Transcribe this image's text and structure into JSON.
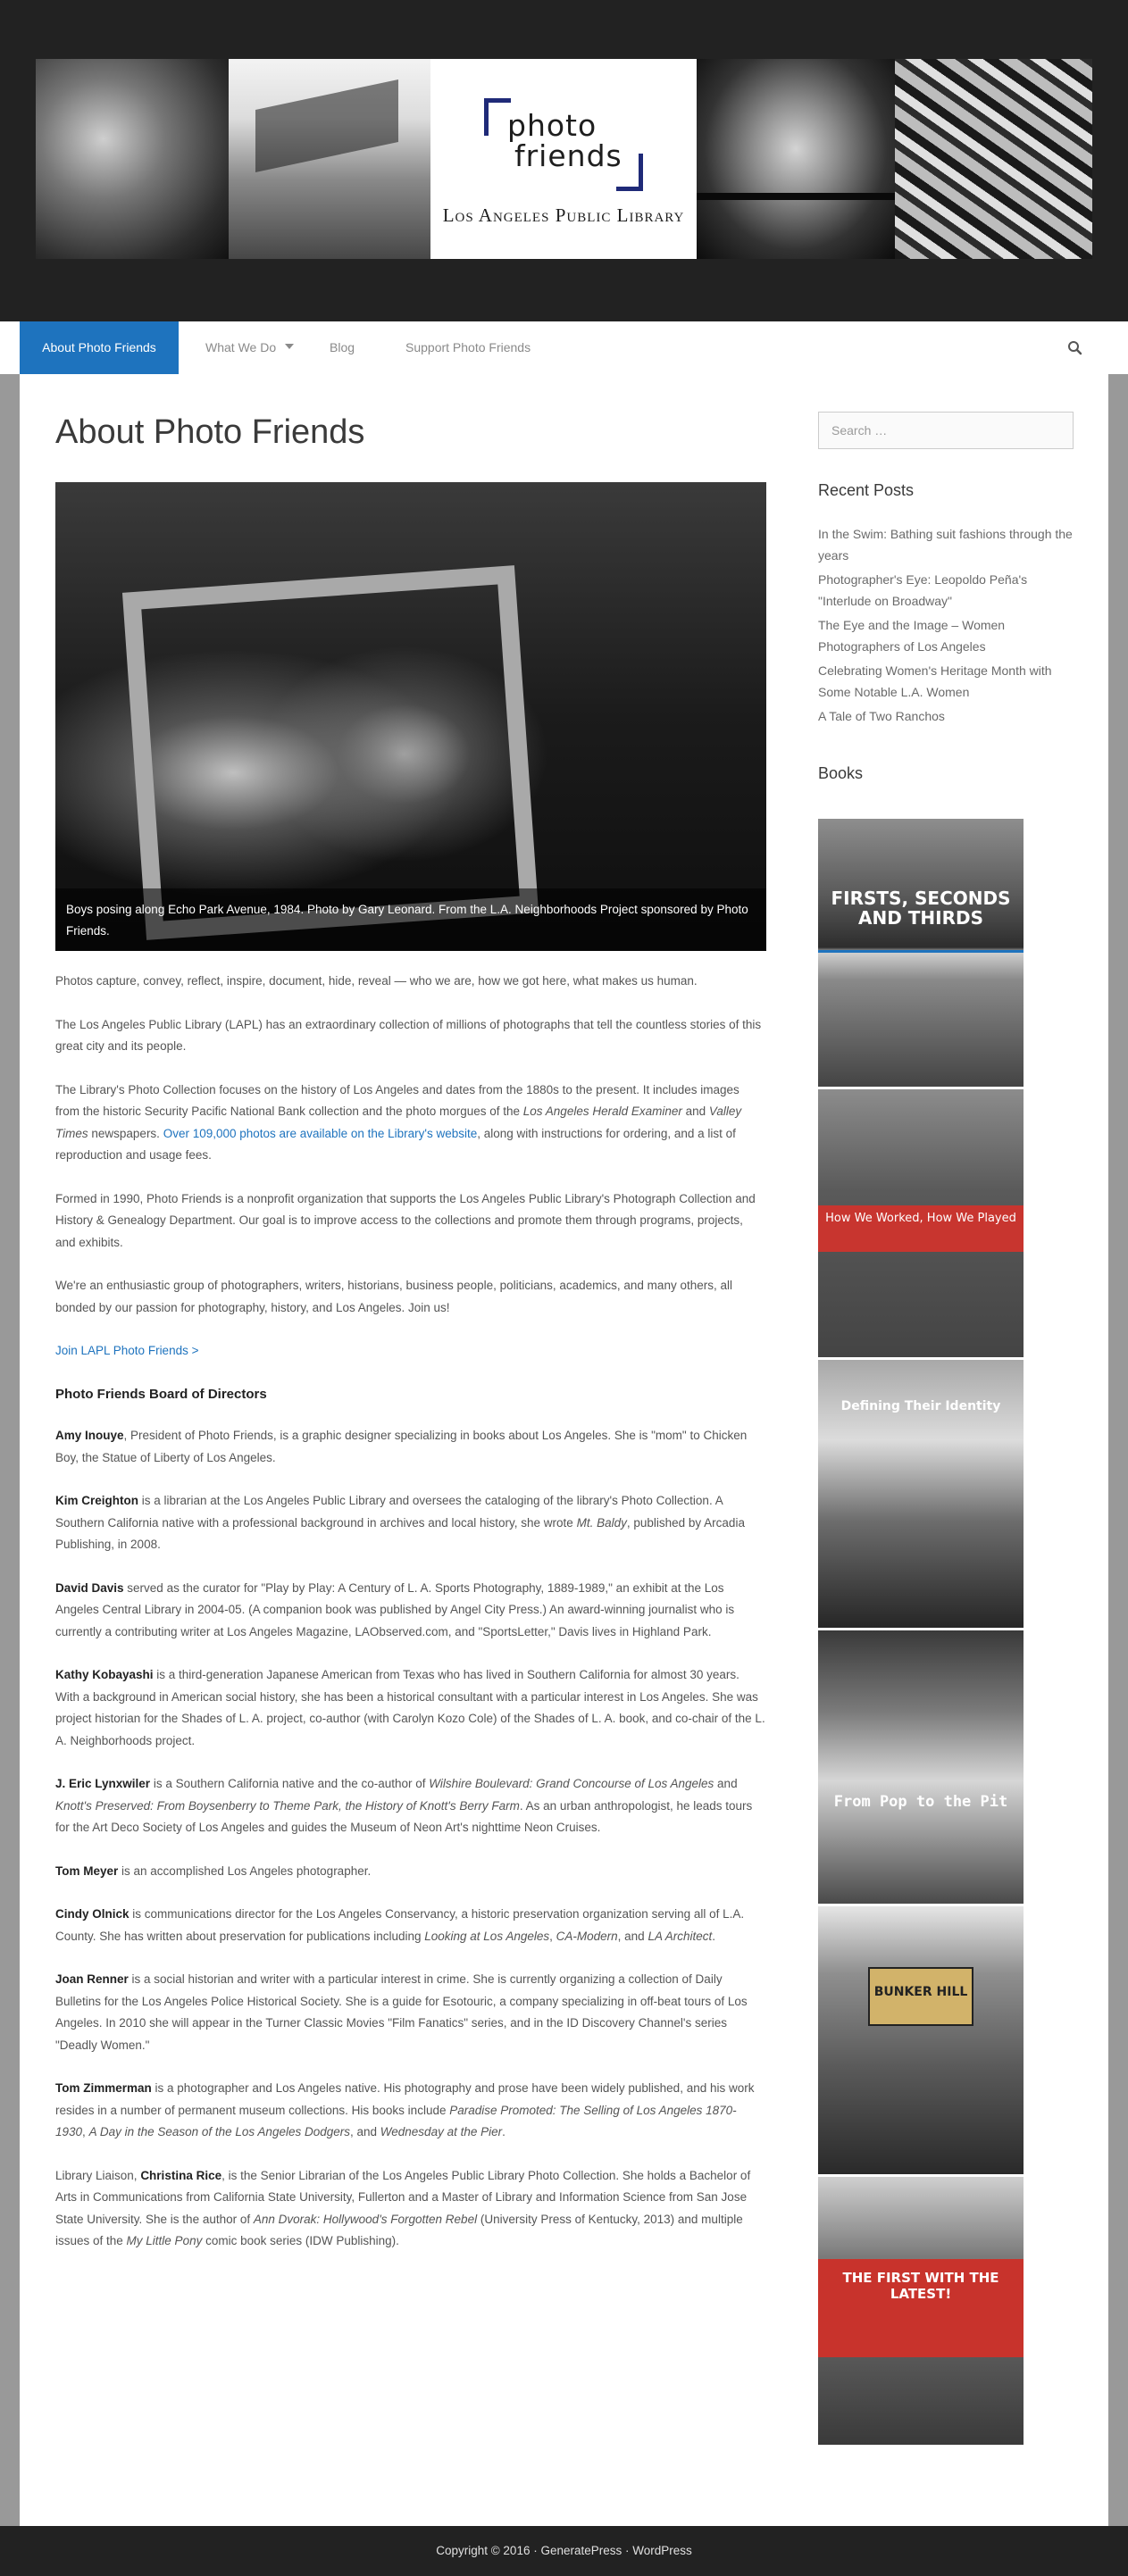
{
  "header": {
    "logo_line1": "photo",
    "logo_line2": "friends",
    "logo_sub": "Los Angeles Public Library"
  },
  "nav": {
    "items": [
      {
        "label": "About Photo Friends",
        "active": true
      },
      {
        "label": "What We Do",
        "active": false,
        "has_dropdown": true
      },
      {
        "label": "Blog",
        "active": false
      },
      {
        "label": "Support Photo Friends",
        "active": false
      }
    ],
    "search_icon": "search-icon"
  },
  "page": {
    "title": "About Photo Friends",
    "caption": "Boys posing along Echo Park Avenue, 1984. Photo by Gary Leonard. From the L.A. Neighborhoods Project sponsored by Photo Friends.",
    "p1": "Photos capture, convey, reflect, inspire, document, hide, reveal — who we are, how we got here, what makes us human.",
    "p2": "The Los Angeles Public Library (LAPL) has an extraordinary collection of millions of photographs that tell the countless stories of this great city and its people.",
    "p3a": "The Library's Photo Collection focuses on the history of Los Angeles and dates from the 1880s to the present. It includes images from the historic Security Pacific National Bank collection and the photo morgues of the ",
    "p3b": "Los Angeles Herald Examiner",
    "p3c": " and ",
    "p3d": "Valley Times",
    "p3e": " newspapers. ",
    "p3link": "Over 109,000 photos are available on the Library's website",
    "p3f": ", along with instructions for ordering, and a list of reproduction and usage fees.",
    "p4": "Formed in 1990, Photo Friends is a nonprofit organization that supports the Los Angeles Public Library's Photograph Collection and History & Genealogy Department. Our goal is to improve access to the collections and promote them through programs, projects, and exhibits.",
    "p5": "We're an enthusiastic group of photographers, writers, historians, business people, politicians, academics, and many others, all bonded by our passion for photography, history, and Los Angeles. Join us!",
    "join_link": "Join LAPL Photo Friends >",
    "board_heading": "Photo Friends Board of Directors",
    "board": [
      {
        "name": "Amy Inouye",
        "text": ", President of Photo Friends, is a graphic designer specializing in books about Los Angeles. She is \"mom\" to Chicken Boy, the Statue of Liberty of Los Angeles."
      },
      {
        "name": "Kim Creighton",
        "text": " is a librarian at the Los Angeles Public Library and oversees the cataloging of the library's Photo Collection. A Southern California native with a professional background in archives and local history, she wrote ",
        "em": "Mt. Baldy",
        "text2": ", published by Arcadia Publishing, in 2008."
      },
      {
        "name": "David Davis",
        "text": " served as the curator for \"Play by Play: A Century of L. A. Sports Photography, 1889-1989,\" an exhibit at the Los Angeles Central Library in 2004-05. (A companion book was published by Angel City Press.) An award-winning journalist who is currently a contributing writer at Los Angeles Magazine, LAObserved.com, and \"SportsLetter,\" Davis lives in Highland Park."
      },
      {
        "name": "Kathy Kobayashi",
        "text": " is a third-generation Japanese American from Texas who has lived in Southern California for almost 30 years. With a background in American social history, she has been a historical consultant with a particular interest in Los Angeles. She was project historian for the Shades of L. A. project, co-author (with Carolyn Kozo Cole) of the Shades of L. A. book, and co-chair of the L. A. Neighborhoods project."
      },
      {
        "name": "J. Eric Lynxwiler",
        "text": " is a Southern California native and the co-author of ",
        "em": "Wilshire Boulevard: Grand Concourse of Los Angeles",
        "text2": " and ",
        "em2": "Knott's Preserved: From Boysenberry to Theme Park, the History of Knott's Berry Farm",
        "text3": ". As an urban anthropologist, he leads tours for the Art Deco Society of Los Angeles and guides the Museum of Neon Art's nighttime Neon Cruises."
      },
      {
        "name": "Tom Meyer",
        "text": " is an accomplished Los Angeles photographer."
      },
      {
        "name": "Cindy Olnick",
        "text": " is communications director for the Los Angeles Conservancy, a historic preservation organization serving all of L.A. County. She has written about preservation for publications including ",
        "em": "Looking at Los Angeles",
        "text2": ", ",
        "em2": "CA-Modern",
        "text3": ", and ",
        "em3": "LA Architect",
        "text4": "."
      },
      {
        "name": "Joan Renner",
        "text": " is a social historian and writer with a particular interest in crime. She is currently organizing a collection of Daily Bulletins for the Los Angeles Police Historical Society. She is a guide for Esotouric, a company specializing in off-beat tours of Los Angeles. In 2010 she will appear in the Turner Classic Movies \"Film Fanatics\" series, and in the ID Discovery Channel's series \"Deadly Women.\""
      },
      {
        "name": "Tom Zimmerman",
        "text": " is a photographer and Los Angeles native. His photography and prose have been widely published, and his work resides in a number of permanent museum collections. His books include ",
        "em": "Paradise Promoted: The Selling of Los Angeles 1870-1930",
        "text2": ", ",
        "em2": "A Day in the Season of the Los Angeles Dodgers",
        "text3": ", and ",
        "em3": "Wednesday at the Pier",
        "text4": "."
      }
    ],
    "liaison_pre": "Library Liaison, ",
    "liaison_name": "Christina Rice",
    "liaison_text": ", is the Senior Librarian of the Los Angeles Public Library Photo Collection. She holds a Bachelor of Arts in Communications from California State University, Fullerton and a Master of Library and Information Science from San Jose State University. She is the author of ",
    "liaison_em": "Ann Dvorak: Hollywood's Forgotten Rebel",
    "liaison_text2": " (University Press of Kentucky, 2013) and multiple issues of the ",
    "liaison_em2": "My Little Pony",
    "liaison_text3": " comic book series (IDW Publishing)."
  },
  "sidebar": {
    "search_placeholder": "Search …",
    "recent_title": "Recent Posts",
    "recent_posts": [
      "In the Swim: Bathing suit fashions through the years",
      "Photographer's Eye: Leopoldo Peña's \"Interlude on Broadway\"",
      "The Eye and the Image – Women Photographers of Los Angeles",
      "Celebrating Women's Heritage Month with Some Notable L.A. Women",
      "A Tale of Two Ranchos"
    ],
    "books_title": "Books",
    "books": [
      {
        "title": "FIRSTS, SECONDS AND THIRDS"
      },
      {
        "title": "How We Worked, How We Played"
      },
      {
        "title": "Defining Their Identity"
      },
      {
        "title": "From Pop to the Pit"
      },
      {
        "title": "BUNKER HILL"
      },
      {
        "title": "THE FIRST WITH THE LATEST!"
      }
    ]
  },
  "footer": {
    "text": "Copyright © 2016 · GeneratePress · WordPress"
  },
  "colors": {
    "accent": "#1e73be",
    "header_bg": "#222222",
    "page_bg": "#999999"
  }
}
